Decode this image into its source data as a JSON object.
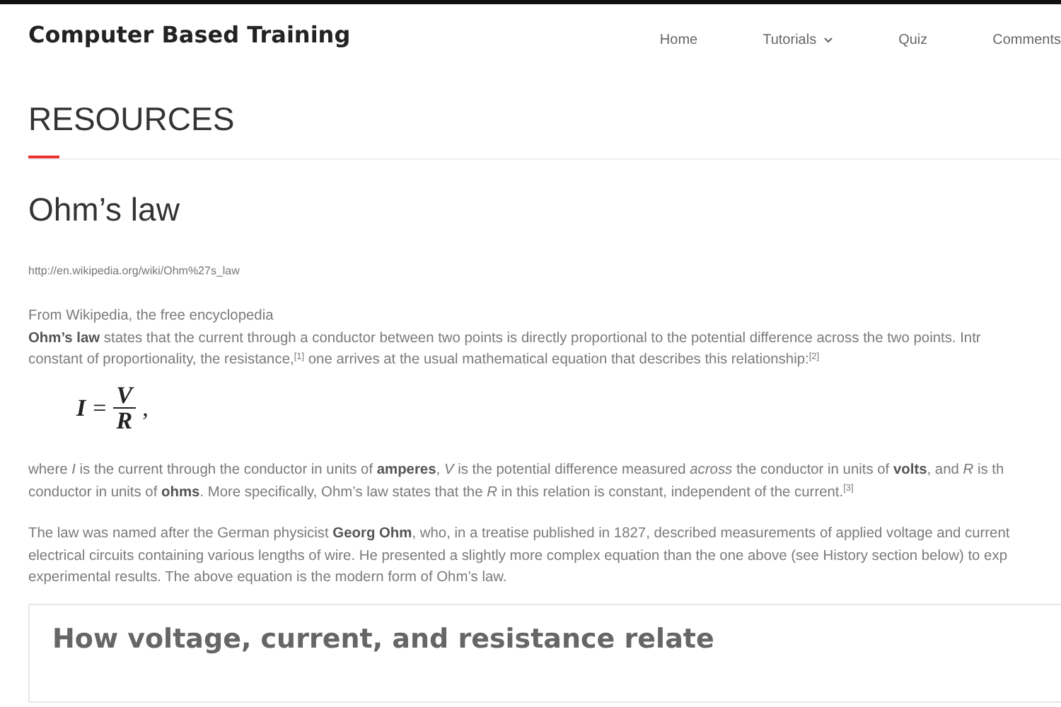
{
  "header": {
    "brand": "Computer Based Training",
    "nav": [
      {
        "label": "Home",
        "dropdown": false
      },
      {
        "label": "Tutorials",
        "dropdown": true
      },
      {
        "label": "Quiz",
        "dropdown": false
      },
      {
        "label": "Comments",
        "dropdown": false
      }
    ]
  },
  "page_title": "RESOURCES",
  "article": {
    "title": "Ohm’s law",
    "blocks": [
      {
        "kind": "link",
        "text": "http://en.wikipedia.org/wiki/Ohm%27s_law"
      },
      {
        "kind": "lines",
        "lines": [
          "From Wikipedia, the free encyclopedia",
          "**Ohm’s law** states that the current through a conductor between two points is directly proportional to the potential difference across the two points. Intr",
          "constant of proportionality, the resistance,$^{[1]}$ one arrives at the usual mathematical equation that describes this relationship:$^{[2]}$"
        ]
      },
      {
        "kind": "equation",
        "lhs": "I",
        "sign": "=",
        "numerator": "V",
        "denominator": "R",
        "trail": ","
      },
      {
        "kind": "lines",
        "lines": [
          "where *I* is the current through the conductor in units of **amperes**, *V* is the potential difference measured *across* the conductor in units of **volts**, and *R* is th",
          "conductor in units of **ohms**. More specifically, Ohm’s law states that the *R* in this relation is constant, independent of the current.$^{[3]}$"
        ]
      },
      {
        "kind": "lines",
        "lines": [
          "The law was named after the German physicist **Georg Ohm**, who, in a treatise published in 1827, described measurements of applied voltage and current",
          "electrical circuits containing various lengths of wire. He presented a slightly more complex equation than the one above (see History section below) to exp",
          "experimental results. The above equation is the modern form of Ohm’s law."
        ]
      }
    ]
  },
  "section": {
    "title": "How voltage, current, and resistance relate"
  }
}
